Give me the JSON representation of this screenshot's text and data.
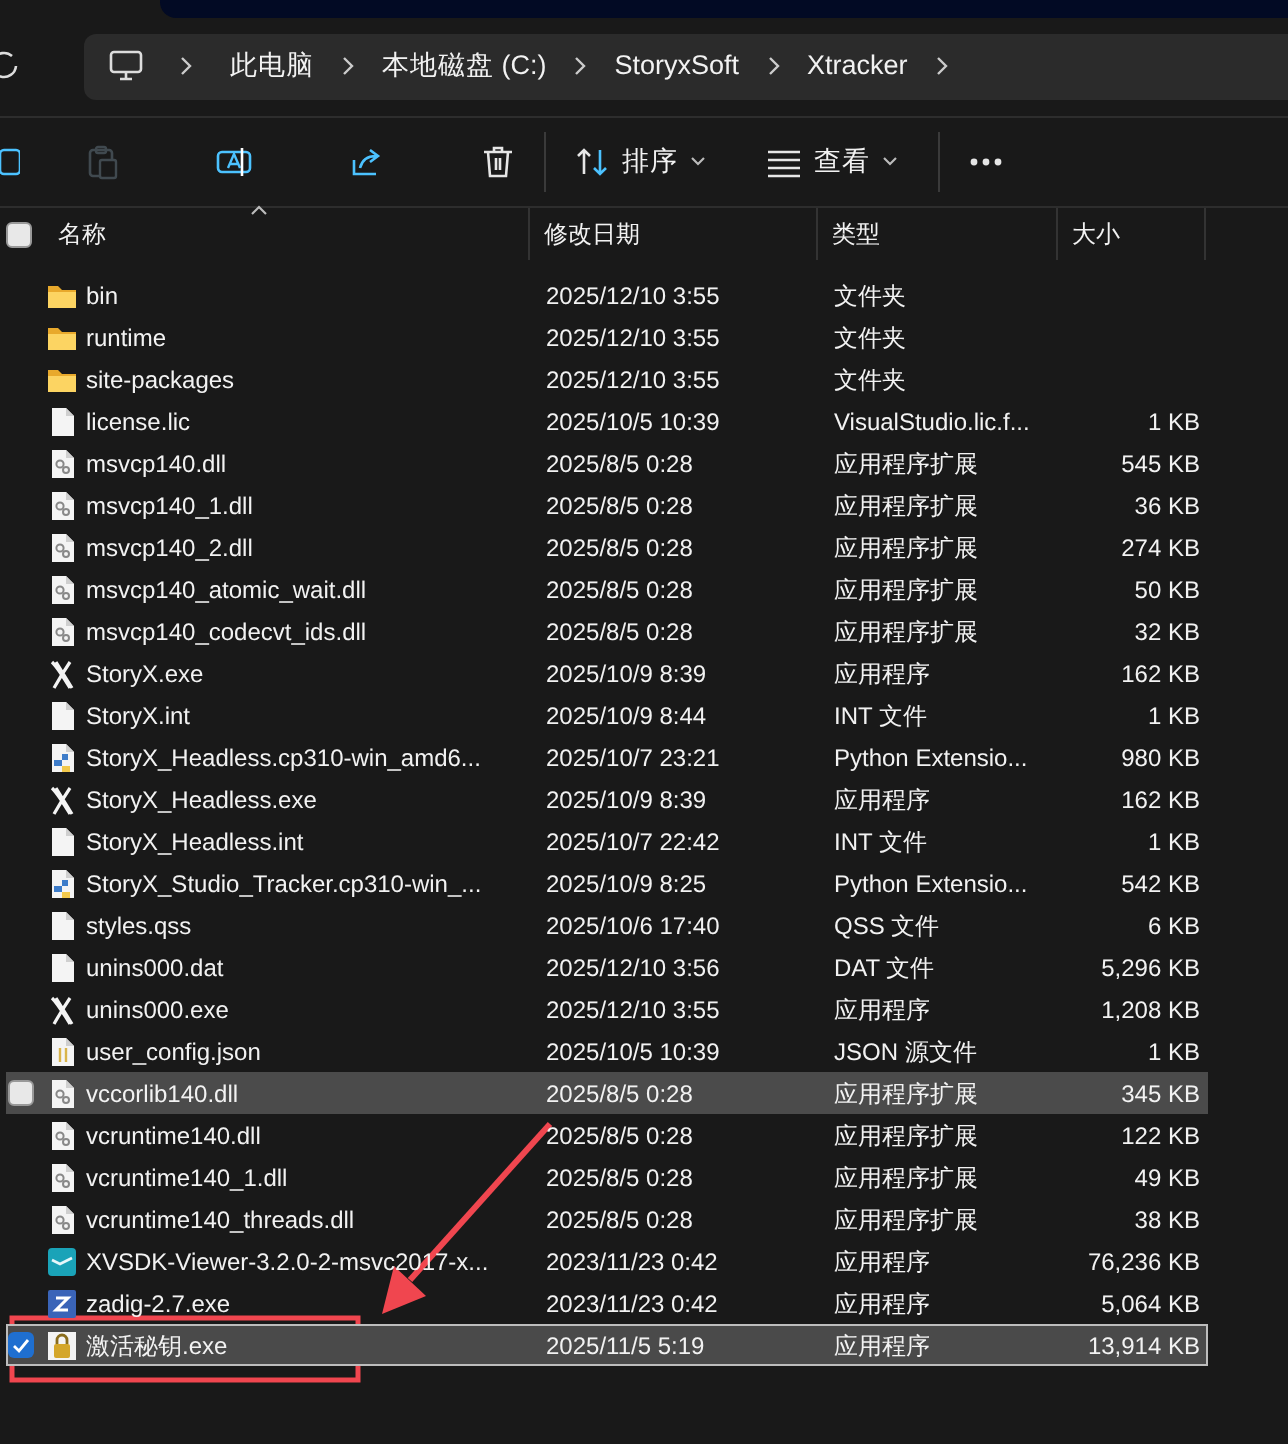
{
  "breadcrumb": [
    {
      "label": "此电脑"
    },
    {
      "label": "本地磁盘 (C:)"
    },
    {
      "label": "StoryxSoft"
    },
    {
      "label": "Xtracker"
    }
  ],
  "toolbar": [
    {
      "kind": "copy",
      "disabled": false
    },
    {
      "kind": "paste",
      "disabled": true
    },
    {
      "kind": "rename",
      "disabled": false
    },
    {
      "kind": "share",
      "disabled": false
    },
    {
      "kind": "delete",
      "disabled": false
    },
    {
      "kind": "sort",
      "label": "排序",
      "disabled": false
    },
    {
      "kind": "view",
      "label": "查看",
      "disabled": false
    },
    {
      "kind": "more",
      "disabled": false
    }
  ],
  "header_checkbox": {
    "checked": false
  },
  "columns": [
    {
      "label": "名称",
      "sorted": true
    },
    {
      "label": "修改日期",
      "sorted": false
    },
    {
      "label": "类型",
      "sorted": false
    },
    {
      "label": "大小",
      "sorted": false
    }
  ],
  "rows": [
    {
      "kind": "folder",
      "name": "bin",
      "date": "2025/12/10 3:55",
      "type": "文件夹",
      "selected": false,
      "hovered": false
    },
    {
      "kind": "folder",
      "name": "runtime",
      "date": "2025/12/10 3:55",
      "type": "文件夹",
      "selected": false,
      "hovered": false
    },
    {
      "kind": "folder",
      "name": "site-packages",
      "date": "2025/12/10 3:55",
      "type": "文件夹",
      "selected": false,
      "hovered": false
    },
    {
      "kind": "file",
      "name": "license.lic",
      "date": "2025/10/5 10:39",
      "type": "VisualStudio.lic.f...",
      "size": "1 KB",
      "selected": false,
      "hovered": false
    },
    {
      "kind": "library",
      "name": "msvcp140.dll",
      "date": "2025/8/5 0:28",
      "type": "应用程序扩展",
      "size": "545 KB",
      "selected": false,
      "hovered": false
    },
    {
      "kind": "library",
      "name": "msvcp140_1.dll",
      "date": "2025/8/5 0:28",
      "type": "应用程序扩展",
      "size": "36 KB",
      "selected": false,
      "hovered": false
    },
    {
      "kind": "library",
      "name": "msvcp140_2.dll",
      "date": "2025/8/5 0:28",
      "type": "应用程序扩展",
      "size": "274 KB",
      "selected": false,
      "hovered": false
    },
    {
      "kind": "library",
      "name": "msvcp140_atomic_wait.dll",
      "date": "2025/8/5 0:28",
      "type": "应用程序扩展",
      "size": "50 KB",
      "selected": false,
      "hovered": false
    },
    {
      "kind": "library",
      "name": "msvcp140_codecvt_ids.dll",
      "date": "2025/8/5 0:28",
      "type": "应用程序扩展",
      "size": "32 KB",
      "selected": false,
      "hovered": false
    },
    {
      "kind": "program",
      "name": "StoryX.exe",
      "date": "2025/10/9 8:39",
      "type": "应用程序",
      "size": "162 KB",
      "selected": false,
      "hovered": false
    },
    {
      "kind": "file",
      "name": "StoryX.int",
      "date": "2025/10/9 8:44",
      "type": "INT 文件",
      "size": "1 KB",
      "selected": false,
      "hovered": false
    },
    {
      "kind": "python",
      "name": "StoryX_Headless.cp310-win_amd6...",
      "date": "2025/10/7 23:21",
      "type": "Python Extensio...",
      "size": "980 KB",
      "selected": false,
      "hovered": false
    },
    {
      "kind": "program",
      "name": "StoryX_Headless.exe",
      "date": "2025/10/9 8:39",
      "type": "应用程序",
      "size": "162 KB",
      "selected": false,
      "hovered": false
    },
    {
      "kind": "file",
      "name": "StoryX_Headless.int",
      "date": "2025/10/7 22:42",
      "type": "INT 文件",
      "size": "1 KB",
      "selected": false,
      "hovered": false
    },
    {
      "kind": "python",
      "name": "StoryX_Studio_Tracker.cp310-win_...",
      "date": "2025/10/9 8:25",
      "type": "Python Extensio...",
      "size": "542 KB",
      "selected": false,
      "hovered": false
    },
    {
      "kind": "file",
      "name": "styles.qss",
      "date": "2025/10/6 17:40",
      "type": "QSS 文件",
      "size": "6 KB",
      "selected": false,
      "hovered": false
    },
    {
      "kind": "file",
      "name": "unins000.dat",
      "date": "2025/12/10 3:56",
      "type": "DAT 文件",
      "size": "5,296 KB",
      "selected": false,
      "hovered": false
    },
    {
      "kind": "program",
      "name": "unins000.exe",
      "date": "2025/12/10 3:55",
      "type": "应用程序",
      "size": "1,208 KB",
      "selected": false,
      "hovered": false
    },
    {
      "kind": "json",
      "name": "user_config.json",
      "date": "2025/10/5 10:39",
      "type": "JSON 源文件",
      "size": "1 KB",
      "selected": false,
      "hovered": false
    },
    {
      "kind": "library",
      "name": "vccorlib140.dll",
      "date": "2025/8/5 0:28",
      "type": "应用程序扩展",
      "size": "345 KB",
      "selected": false,
      "hovered": true
    },
    {
      "kind": "library",
      "name": "vcruntime140.dll",
      "date": "2025/8/5 0:28",
      "type": "应用程序扩展",
      "size": "122 KB",
      "selected": false,
      "hovered": false
    },
    {
      "kind": "library",
      "name": "vcruntime140_1.dll",
      "date": "2025/8/5 0:28",
      "type": "应用程序扩展",
      "size": "49 KB",
      "selected": false,
      "hovered": false
    },
    {
      "kind": "library",
      "name": "vcruntime140_threads.dll",
      "date": "2025/8/5 0:28",
      "type": "应用程序扩展",
      "size": "38 KB",
      "selected": false,
      "hovered": false
    },
    {
      "kind": "app",
      "name": "XVSDK-Viewer-3.2.0-2-msvc2017-x...",
      "date": "2023/11/23 0:42",
      "type": "应用程序",
      "size": "76,236 KB",
      "selected": false,
      "hovered": false
    },
    {
      "kind": "installer",
      "name": "zadig-2.7.exe",
      "date": "2023/11/23 0:42",
      "type": "应用程序",
      "size": "5,064 KB",
      "selected": false,
      "hovered": false
    },
    {
      "kind": "locked",
      "name": "激活秘钥.exe",
      "date": "2025/11/5 5:19",
      "type": "应用程序",
      "size": "13,914 KB",
      "selected": true,
      "hovered": false
    }
  ],
  "annotations": {
    "arrow": true,
    "box": true
  }
}
